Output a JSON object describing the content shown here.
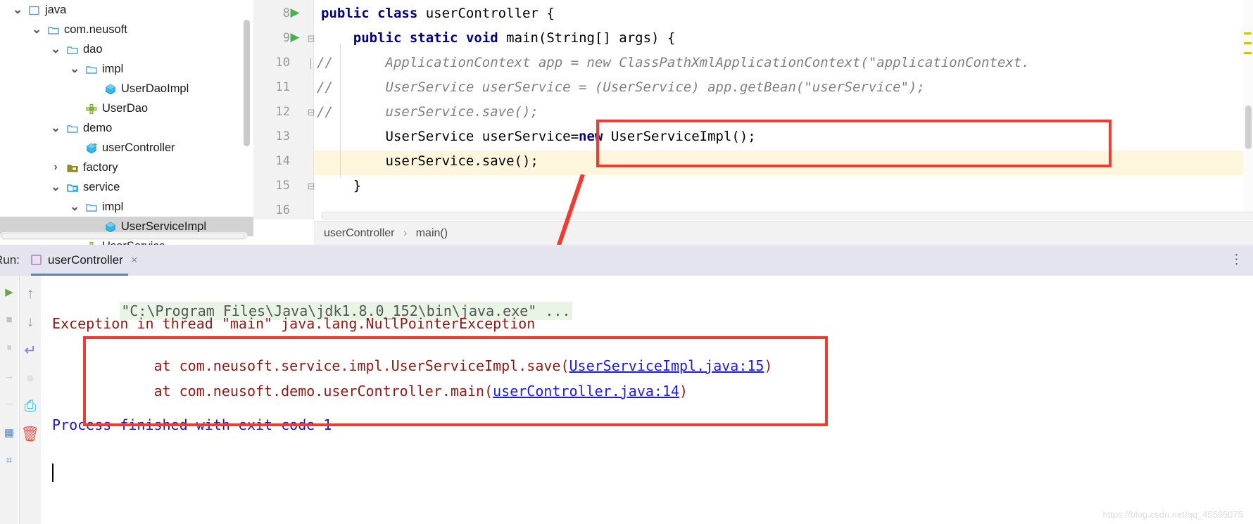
{
  "project_tree": {
    "rows": [
      {
        "label": "java",
        "indent": 0,
        "twisty": "v",
        "icon": "module-icon",
        "selected": false
      },
      {
        "label": "com.neusoft",
        "indent": 1,
        "twisty": "v",
        "icon": "package-folder-icon",
        "selected": false
      },
      {
        "label": "dao",
        "indent": 2,
        "twisty": "v",
        "icon": "package-folder-icon",
        "selected": false
      },
      {
        "label": "impl",
        "indent": 3,
        "twisty": "v",
        "icon": "package-folder-icon",
        "selected": false
      },
      {
        "label": "UserDaoImpl",
        "indent": 4,
        "twisty": "",
        "icon": "java-class-icon",
        "selected": false
      },
      {
        "label": "UserDao",
        "indent": 3,
        "twisty": "",
        "icon": "java-interface-icon",
        "selected": false
      },
      {
        "label": "demo",
        "indent": 2,
        "twisty": "v",
        "icon": "package-folder-icon",
        "selected": false
      },
      {
        "label": "userController",
        "indent": 3,
        "twisty": "",
        "icon": "java-runnable-class-icon",
        "selected": false
      },
      {
        "label": "factory",
        "indent": 2,
        "twisty": ">",
        "icon": "resource-folder-icon",
        "selected": false
      },
      {
        "label": "service",
        "indent": 2,
        "twisty": "v",
        "icon": "source-folder-icon",
        "selected": false
      },
      {
        "label": "impl",
        "indent": 3,
        "twisty": "v",
        "icon": "package-folder-icon",
        "selected": false
      },
      {
        "label": "UserServiceImpl",
        "indent": 4,
        "twisty": "",
        "icon": "java-class-icon",
        "selected": true
      },
      {
        "label": "UserService",
        "indent": 3,
        "twisty": "",
        "icon": "java-interface-icon",
        "selected": false
      }
    ]
  },
  "editor": {
    "lines": [
      {
        "number": "8",
        "runmark": true,
        "fold": "",
        "comment_slashes": "",
        "text": "public class userController {",
        "tokens": [
          {
            "t": "public",
            "c": "kw"
          },
          {
            "t": " ",
            "c": ""
          },
          {
            "t": "class",
            "c": "kw"
          },
          {
            "t": " userController {",
            "c": ""
          }
        ]
      },
      {
        "number": "9",
        "runmark": true,
        "fold": "top",
        "comment_slashes": "",
        "text": "    public static void main(String[] args) {",
        "tokens": [
          {
            "t": "    ",
            "c": ""
          },
          {
            "t": "public",
            "c": "kw"
          },
          {
            "t": " ",
            "c": ""
          },
          {
            "t": "static",
            "c": "kw"
          },
          {
            "t": " ",
            "c": ""
          },
          {
            "t": "void",
            "c": "kw"
          },
          {
            "t": " main(String[] args) {",
            "c": ""
          }
        ]
      },
      {
        "number": "10",
        "runmark": false,
        "fold": "mid",
        "comment_slashes": "//",
        "text": "        ApplicationContext app = new ClassPathXmlApplicationContext(\"applicationContext.",
        "tokens": [
          {
            "t": "        ApplicationContext app = new ClassPathXmlApplicationContext(\"applicationContext.",
            "c": "cmt"
          }
        ]
      },
      {
        "number": "11",
        "runmark": false,
        "fold": "",
        "comment_slashes": "//",
        "text": "        UserService userService = (UserService) app.getBean(\"userService\");",
        "tokens": [
          {
            "t": "        UserService userService = (UserService) app.getBean(\"userService\");",
            "c": "cmt"
          }
        ]
      },
      {
        "number": "12",
        "runmark": false,
        "fold": "bot",
        "comment_slashes": "//",
        "text": "        userService.save();",
        "tokens": [
          {
            "t": "        userService.save();",
            "c": "cmt"
          }
        ]
      },
      {
        "number": "13",
        "runmark": false,
        "fold": "",
        "comment_slashes": "",
        "text": "        UserService userService=new UserServiceImpl();",
        "tokens": [
          {
            "t": "        UserService userService=",
            "c": ""
          },
          {
            "t": "new",
            "c": "kw"
          },
          {
            "t": " UserServiceImpl();",
            "c": ""
          }
        ]
      },
      {
        "number": "14",
        "runmark": false,
        "fold": "",
        "comment_slashes": "",
        "text": "        userService.save();",
        "tokens": [
          {
            "t": "        userService.save();",
            "c": ""
          }
        ]
      },
      {
        "number": "15",
        "runmark": false,
        "fold": "bot2",
        "comment_slashes": "",
        "text": "    }",
        "tokens": [
          {
            "t": "    }",
            "c": ""
          }
        ]
      },
      {
        "number": "16",
        "runmark": false,
        "fold": "",
        "comment_slashes": "",
        "text": "",
        "tokens": [
          {
            "t": "",
            "c": ""
          }
        ]
      }
    ],
    "highlighted_line": "14",
    "breadcrumb": [
      "userController",
      "main()"
    ],
    "breadcrumb_separator": "›"
  },
  "run_tool_window": {
    "title": "Run:",
    "tab_label": "userController",
    "tab_close_glyph": "×",
    "options_glyph": "⋮",
    "toolbar": [
      {
        "name": "rerun-icon",
        "glyph": "▶",
        "color": "#6aa84f"
      },
      {
        "name": "stop-icon",
        "glyph": "■",
        "color": "#c0c0c0"
      },
      {
        "name": "pause-icon",
        "glyph": "⏸",
        "color": "#c0c0c0"
      },
      {
        "name": "resume-icon",
        "glyph": "→",
        "color": "#c0c0c0"
      },
      {
        "name": "separator-icon",
        "glyph": "─",
        "color": "#d0d0d0"
      },
      {
        "name": "layout-icon",
        "glyph": "▦",
        "color": "#4a86c8"
      },
      {
        "name": "settings-icon",
        "glyph": "⌗",
        "color": "#4a86c8"
      }
    ],
    "toolbar2": [
      {
        "name": "scroll-up-icon",
        "glyph": "↑",
        "color": "#5fb3ae"
      },
      {
        "name": "scroll-down-icon",
        "glyph": "↓",
        "color": "#5fb3ae"
      },
      {
        "name": "soft-wrap-icon",
        "glyph": "↵",
        "color": "#7b86d8"
      },
      {
        "name": "circle-icon",
        "glyph": "●",
        "color": "#e2e2e2"
      },
      {
        "name": "print-icon",
        "glyph": "⎙",
        "color": "#2fc0d8"
      },
      {
        "name": "trash-icon",
        "glyph": "🗑",
        "color": "#e4564a"
      }
    ],
    "console": {
      "command_line": "\"C:\\Program Files\\Java\\jdk1.8.0_152\\bin\\java.exe\" ...",
      "exception_header": "Exception in thread \"main\" java.lang.NullPointerException",
      "stack_frames": [
        {
          "prefix": "    at com.neusoft.service.impl.UserServiceImpl.save(",
          "link": "UserServiceImpl.java:15",
          "suffix": ")"
        },
        {
          "prefix": "    at com.neusoft.demo.userController.main(",
          "link": "userController.java:14",
          "suffix": ")"
        }
      ],
      "process_result": "Process finished with exit code 1"
    }
  },
  "annotations": {
    "code_highlight_box_color": "#f23b2f",
    "console_highlight_box_color": "#f23b2f",
    "arrow_color": "#f23b2f"
  },
  "watermark": "https://blog.csdn.net/qq_45565075"
}
